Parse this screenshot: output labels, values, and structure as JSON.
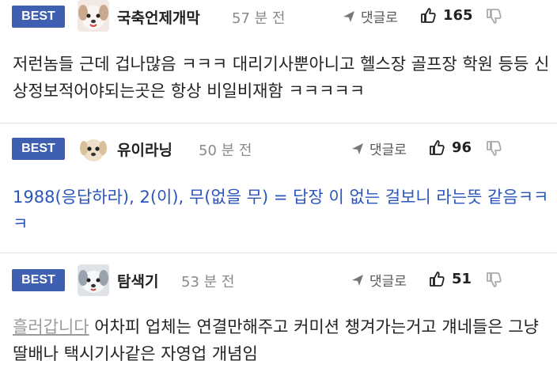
{
  "comments": [
    {
      "badge": "BEST",
      "nickname": "국축언제개막",
      "time": "57 분 전",
      "reply_label": "댓글로",
      "likes": "165",
      "avatar_icon": "puppy-white-avatar",
      "text": "저런놈들 근데 겁나많음 ㅋㅋㅋ 대리기사뿐아니고 헬스장 골프장 학원 등등 신상정보적어야되는곳은 항상 비일비재함 ㅋㅋㅋㅋㅋ"
    },
    {
      "badge": "BEST",
      "nickname": "유이라닝",
      "time": "50 분 전",
      "reply_label": "댓글로",
      "likes": "96",
      "avatar_icon": "puppy-cream-avatar",
      "text": "1988(응답하라), 2(이), 무(없을 무) = 답장 이 없는 걸보니 라는뜻 같음ㅋㅋㅋ"
    },
    {
      "badge": "BEST",
      "nickname": "탐색기",
      "time": "53 분 전",
      "reply_label": "댓글로",
      "likes": "51",
      "avatar_icon": "puppy-gray-avatar",
      "quote": "흘러갑니다",
      "text": " 어차피 업체는 연결만해주고 커미션 챙겨가는거고 걔네들은 그냥 딸배나 택시기사같은 자영업 개념임"
    }
  ],
  "colors": {
    "badge_bg": "#3f5fb0",
    "link_text": "#2b55b8",
    "quote_text": "#9a9a9a"
  }
}
